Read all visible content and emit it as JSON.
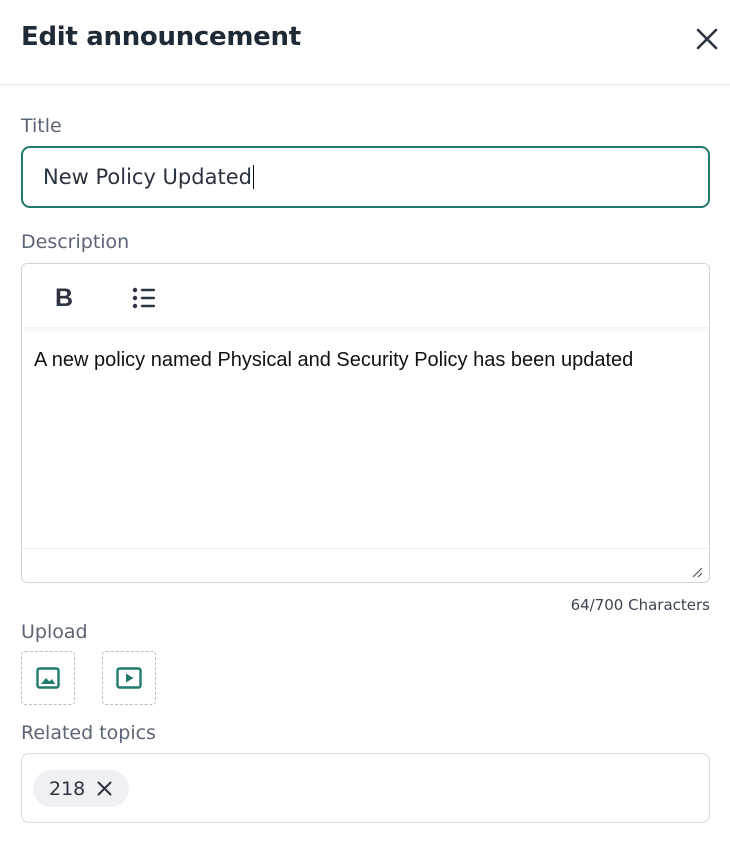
{
  "header": {
    "title": "Edit announcement",
    "close_icon": "close-icon"
  },
  "title_field": {
    "label": "Title",
    "value": "New Policy Updated"
  },
  "description": {
    "label": "Description",
    "toolbar": {
      "bold_label": "B",
      "list_icon": "bulleted-list-icon"
    },
    "content": "A new policy named Physical and Security Policy has been updated",
    "char_count": "64/700 Characters"
  },
  "upload": {
    "label": "Upload",
    "image_icon": "image-icon",
    "video_icon": "video-icon"
  },
  "related_topics": {
    "label": "Related topics",
    "chips": [
      "218"
    ]
  },
  "colors": {
    "accent": "#1f7a6c",
    "label": "#5b6475",
    "chip_bg": "#eef0f3"
  }
}
